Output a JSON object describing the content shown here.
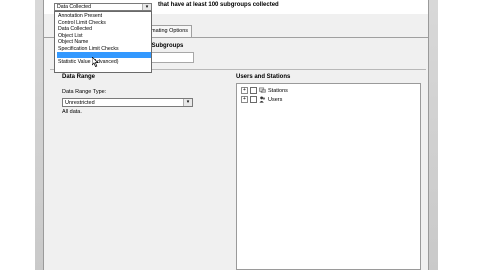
{
  "header": {
    "text": "that have at least 100 subgroups collected"
  },
  "top_select": {
    "value": "Data Collected"
  },
  "dropdown": {
    "items": [
      "Annotation Present",
      "Control Limit Checks",
      "Data Collected",
      "Object List",
      "Object Name",
      "Specification Limit Checks",
      "",
      "Statistic Value (Advanced)"
    ],
    "selected_index": 6
  },
  "tabs": {
    "partial": "omating Options"
  },
  "subgroups": {
    "label": "f Subgroups"
  },
  "data_range": {
    "title": "Data Range",
    "type_label": "Data Range Type:",
    "type_value": "Unrestricted",
    "note": "All data."
  },
  "users_stations": {
    "title": "Users and Stations",
    "items": [
      {
        "label": "Stations",
        "icon": "stations-icon"
      },
      {
        "label": "Users",
        "icon": "users-icon"
      }
    ]
  },
  "colors": {
    "selection": "#3399ff",
    "window": "#f0f0f0"
  }
}
